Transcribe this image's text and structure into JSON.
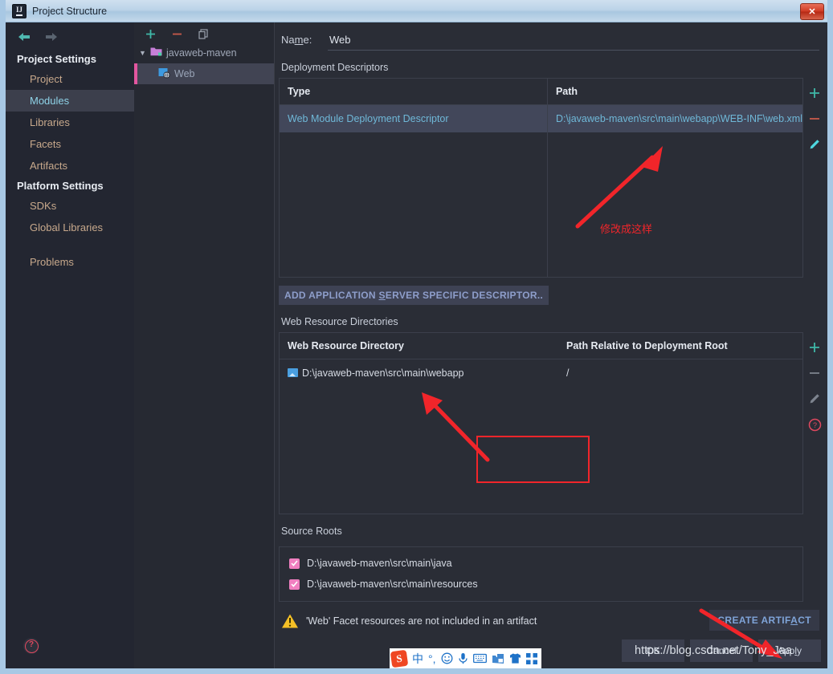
{
  "window": {
    "title": "Project Structure",
    "app_icon": "intellij-idea-icon",
    "close_label": "✕"
  },
  "sidebar": {
    "back_icon": "back-arrow-icon",
    "forward_icon": "forward-arrow-icon",
    "groups": [
      {
        "heading": "Project Settings",
        "items": [
          {
            "label": "Project",
            "selected": false
          },
          {
            "label": "Modules",
            "selected": true
          },
          {
            "label": "Libraries",
            "selected": false
          },
          {
            "label": "Facets",
            "selected": false
          },
          {
            "label": "Artifacts",
            "selected": false
          }
        ]
      },
      {
        "heading": "Platform Settings",
        "items": [
          {
            "label": "SDKs",
            "selected": false
          },
          {
            "label": "Global Libraries",
            "selected": false
          }
        ]
      }
    ],
    "problems_label": "Problems",
    "help_icon": "help-circle-icon"
  },
  "tree": {
    "toolbar": [
      {
        "name": "add-module-button",
        "glyph": "+"
      },
      {
        "name": "remove-module-button",
        "glyph": "−"
      },
      {
        "name": "copy-module-button",
        "glyph": "copy-icon"
      }
    ],
    "nodes": [
      {
        "label": "javaweb-maven",
        "icon": "module-folder-icon",
        "expanded": true,
        "selected": false
      },
      {
        "label": "Web",
        "icon": "web-facet-icon",
        "child": true,
        "selected": true
      }
    ]
  },
  "main": {
    "name_label": "Na",
    "name_label_underlined": "m",
    "name_label_rest": "e:",
    "name_value": "Web",
    "deployment": {
      "title": "Deployment Descriptors",
      "columns": [
        "Type",
        "Path"
      ],
      "rows": [
        {
          "type": "Web Module Deployment Descriptor",
          "path": "D:\\javaweb-maven\\src\\main\\webapp\\WEB-INF\\web.xml",
          "selected": true
        }
      ],
      "tools": [
        {
          "name": "add-descriptor-button",
          "glyph": "+"
        },
        {
          "name": "remove-descriptor-button",
          "glyph": "−"
        },
        {
          "name": "edit-descriptor-button",
          "glyph": "pencil-icon"
        }
      ],
      "add_server_descriptor_pre": "ADD APPLICATION ",
      "add_server_descriptor_key": "S",
      "add_server_descriptor_post": "ERVER SPECIFIC DESCRIPTOR.."
    },
    "web_resources": {
      "title": "Web Resource Directories",
      "columns": [
        "Web Resource Directory",
        "Path Relative to Deployment Root"
      ],
      "rows": [
        {
          "directory": "D:\\javaweb-maven\\src\\main\\webapp",
          "relative_path": "/"
        }
      ],
      "tools": [
        {
          "name": "add-web-resource-button",
          "glyph": "+"
        },
        {
          "name": "remove-web-resource-button",
          "glyph": "−"
        },
        {
          "name": "edit-web-resource-button",
          "glyph": "pencil-icon"
        },
        {
          "name": "web-resource-help-button",
          "glyph": "help-circle-icon"
        }
      ]
    },
    "source_roots": {
      "title": "Source Roots",
      "rows": [
        {
          "path": "D:\\javaweb-maven\\src\\main\\java",
          "checked": true
        },
        {
          "path": "D:\\javaweb-maven\\src\\main\\resources",
          "checked": true
        }
      ]
    },
    "warning": {
      "icon": "warning-triangle-icon",
      "text": "'Web' Facet resources are not included in an artifact",
      "action_pre": "CREATE ARTIF",
      "action_key": "A",
      "action_post": "CT"
    }
  },
  "dialog_buttons": [
    {
      "name": "ok-button",
      "label": "OK"
    },
    {
      "name": "cancel-button",
      "label": "Cancel"
    },
    {
      "name": "apply-button",
      "pre": "App",
      "key": "l",
      "post": "y"
    }
  ],
  "annotations": {
    "note_text": "修改成这样",
    "arrow_color": "#f1252a",
    "box_color": "#f1252a"
  },
  "watermark": {
    "text": "https://blog.csdn.net/Tony_Jaa"
  },
  "ime": {
    "logo": "S",
    "items": [
      {
        "name": "ime-mode-chinese",
        "glyph": "中"
      },
      {
        "name": "ime-punctuation",
        "glyph": "°,"
      },
      {
        "name": "ime-emoji-icon",
        "glyph": "☺"
      },
      {
        "name": "ime-voice-icon",
        "glyph": "🎤"
      },
      {
        "name": "ime-keyboard-icon",
        "glyph": "⌨"
      },
      {
        "name": "ime-screenshot-icon",
        "glyph": "▤"
      },
      {
        "name": "ime-skin-icon",
        "glyph": "👕"
      },
      {
        "name": "ime-toolbox-icon",
        "glyph": "▦"
      }
    ]
  },
  "colors": {
    "accent_link": "#6fb8d8",
    "selection": "#42475a",
    "checkbox": "#f07fc0",
    "warning": "#f5c026",
    "annotation_red": "#f1252a"
  }
}
